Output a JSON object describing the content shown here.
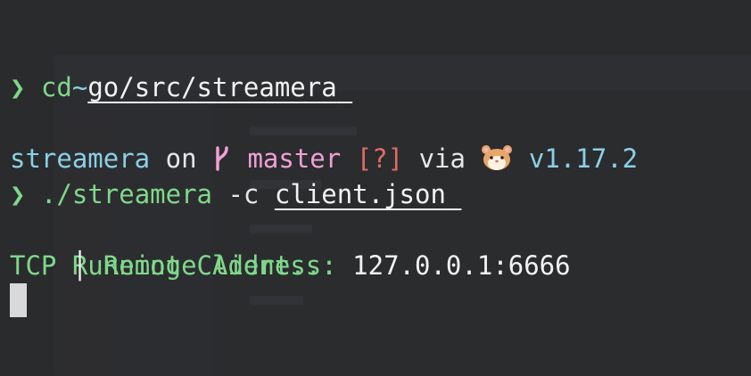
{
  "terminal": {
    "tilde": "~",
    "prompt_symbol": "❯",
    "cmd1": {
      "command": "cd",
      "argument": "go/src/streamera"
    },
    "status_line": {
      "directory": "streamera",
      "on_text": "on",
      "branch_icon": "",
      "branch_icon_name": "git-branch-icon",
      "branch": "master",
      "git_status": "[?]",
      "via_text": "via",
      "lang_icon_name": "hamster-icon",
      "version": "v1.17.2"
    },
    "cmd2": {
      "command": "./streamera",
      "flag": "-c",
      "argument": "client.json"
    },
    "output": {
      "line1": "Running Client...",
      "line2_label": "TCP",
      "line2_sep": "│",
      "line2_key": "Remote Address:",
      "line2_value": "127.0.0.1:6666"
    }
  },
  "colors": {
    "background": "#2a2b2d",
    "green": "#7fd88a",
    "cyan": "#8ad0e6",
    "pink": "#f29fd6",
    "red": "#e06c60",
    "text": "#f2f2f2"
  }
}
